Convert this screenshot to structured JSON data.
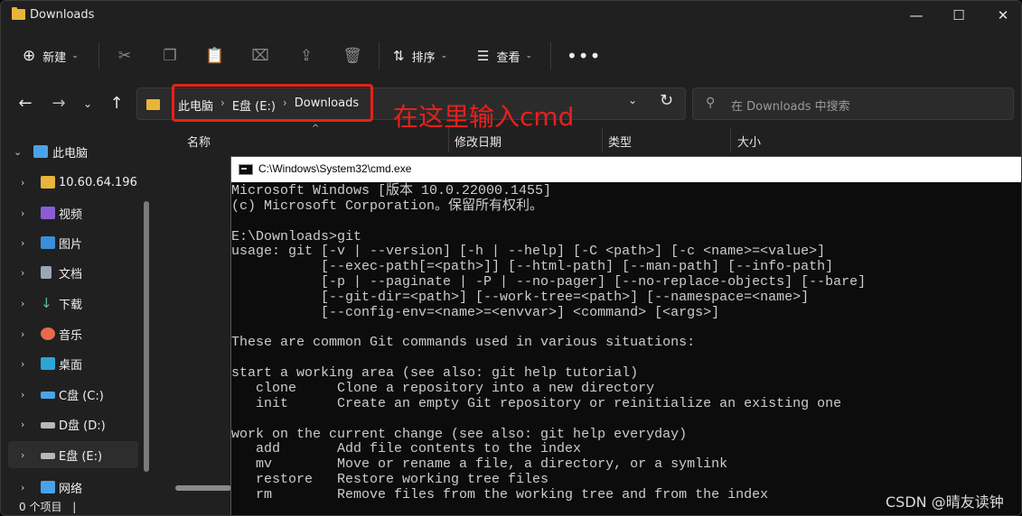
{
  "window": {
    "title": "Downloads"
  },
  "toolbar": {
    "new_label": "新建",
    "sort_label": "排序",
    "view_label": "查看"
  },
  "address": {
    "crumbs": [
      "此电脑",
      "E盘 (E:)",
      "Downloads"
    ]
  },
  "search": {
    "placeholder": "在 Downloads 中搜索"
  },
  "annotation": "在这里输入cmd",
  "sidebar": {
    "items": [
      {
        "label": "此电脑",
        "icon": "computer-icon"
      },
      {
        "label": "10.60.64.196",
        "icon": "network-drive-icon"
      },
      {
        "label": "视频",
        "icon": "video-icon"
      },
      {
        "label": "图片",
        "icon": "picture-icon"
      },
      {
        "label": "文档",
        "icon": "document-icon"
      },
      {
        "label": "下载",
        "icon": "download-icon"
      },
      {
        "label": "音乐",
        "icon": "music-icon"
      },
      {
        "label": "桌面",
        "icon": "desktop-icon"
      },
      {
        "label": "C盘 (C:)",
        "icon": "drive-icon"
      },
      {
        "label": "D盘 (D:)",
        "icon": "drive-icon"
      },
      {
        "label": "E盘 (E:)",
        "icon": "drive-icon"
      },
      {
        "label": "网络",
        "icon": "network-icon"
      }
    ]
  },
  "columns": [
    "名称",
    "修改日期",
    "类型",
    "大小"
  ],
  "status": {
    "item_count": "0 个项目"
  },
  "cmd": {
    "title": "C:\\Windows\\System32\\cmd.exe",
    "lines": [
      "Microsoft Windows [版本 10.0.22000.1455]",
      "(c) Microsoft Corporation。保留所有权利。",
      "",
      "E:\\Downloads>git",
      "usage: git [-v | --version] [-h | --help] [-C <path>] [-c <name>=<value>]",
      "           [--exec-path[=<path>]] [--html-path] [--man-path] [--info-path]",
      "           [-p | --paginate | -P | --no-pager] [--no-replace-objects] [--bare]",
      "           [--git-dir=<path>] [--work-tree=<path>] [--namespace=<name>]",
      "           [--config-env=<name>=<envvar>] <command> [<args>]",
      "",
      "These are common Git commands used in various situations:",
      "",
      "start a working area (see also: git help tutorial)",
      "   clone     Clone a repository into a new directory",
      "   init      Create an empty Git repository or reinitialize an existing one",
      "",
      "work on the current change (see also: git help everyday)",
      "   add       Add file contents to the index",
      "   mv        Move or rename a file, a directory, or a symlink",
      "   restore   Restore working tree files",
      "   rm        Remove files from the working tree and from the index"
    ]
  },
  "watermark": "CSDN @晴友读钟"
}
